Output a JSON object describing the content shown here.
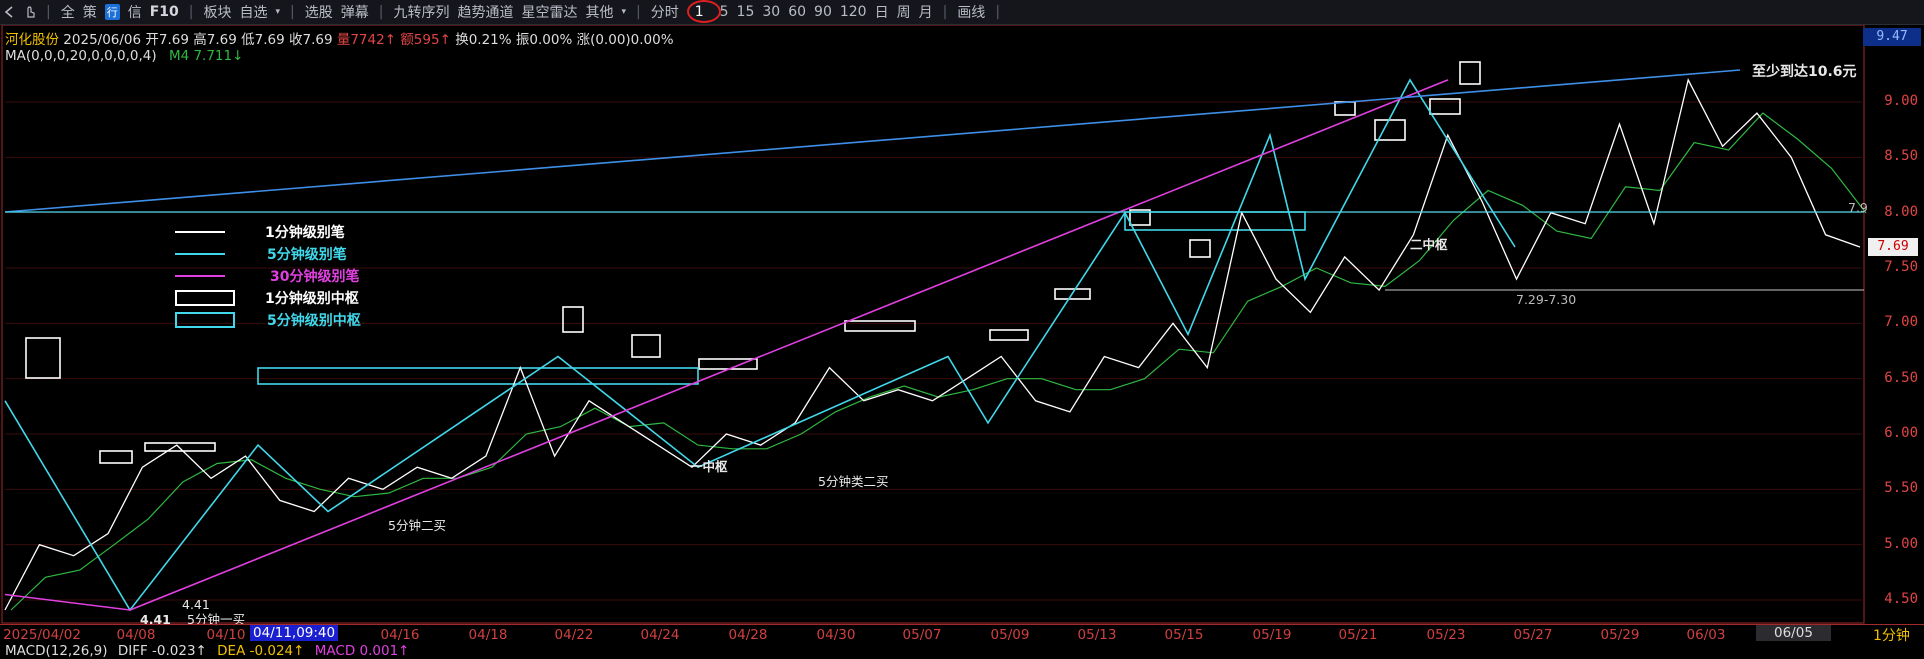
{
  "toolbar": {
    "items": [
      {
        "label": "全"
      },
      {
        "label": "策"
      },
      {
        "label": "行"
      },
      {
        "label": "信"
      },
      {
        "label": "F10"
      },
      {
        "label": "板块"
      },
      {
        "label": "自选"
      },
      {
        "label": "选股"
      },
      {
        "label": "弹幕"
      },
      {
        "label": "九转序列"
      },
      {
        "label": "趋势通道"
      },
      {
        "label": "星空雷达"
      },
      {
        "label": "其他"
      },
      {
        "label": "分时"
      },
      {
        "label": "1"
      },
      {
        "label": "5"
      },
      {
        "label": "15"
      },
      {
        "label": "30"
      },
      {
        "label": "60"
      },
      {
        "label": "90"
      },
      {
        "label": "120"
      },
      {
        "label": "日"
      },
      {
        "label": "周"
      },
      {
        "label": "月"
      },
      {
        "label": "画线"
      }
    ]
  },
  "quote": {
    "name": "河化股份",
    "date": "2025/06/06",
    "open": "开7.69",
    "high": "高7.69",
    "low": "低7.69",
    "close": "收7.69",
    "volume": "量7742↑",
    "amount": "额595↑",
    "turnover": "换0.21%",
    "amplitude": "振0.00%",
    "change": "涨(0.00)0.00%"
  },
  "ma": {
    "params": "MA(0,0,0,20,0,0,0,0,4)",
    "m4": "M4 7.711↓"
  },
  "price_axis": {
    "top": "9.47",
    "current": "7.69",
    "ticks": [
      "9.00",
      "8.50",
      "8.00",
      "7.50",
      "7.00",
      "6.50",
      "6.00",
      "5.50",
      "5.00",
      "4.50"
    ]
  },
  "date_axis": {
    "first": "2025/04/02",
    "cursor": "04/11,09:40",
    "last": "06/05",
    "period": "1分钟",
    "ticks": [
      "04/08",
      "04/10",
      "04/16",
      "04/18",
      "04/22",
      "04/24",
      "04/28",
      "04/30",
      "05/07",
      "05/09",
      "05/13",
      "05/15",
      "05/19",
      "05/21",
      "05/23",
      "05/27",
      "05/29",
      "06/03"
    ]
  },
  "macd": {
    "params": "MACD(12,26,9)",
    "diff": "DIFF -0.023↑",
    "dea": "DEA -0.024↑",
    "macd": "MACD 0.001↑"
  },
  "legend": {
    "items": [
      {
        "label": "1分钟级别笔",
        "color": "#ffffff"
      },
      {
        "label": "5分钟级别笔",
        "color": "#40d8ea"
      },
      {
        "label": "30分钟级别笔",
        "color": "#e040e0"
      },
      {
        "label": "1分钟级别中枢",
        "color": "#ffffff"
      },
      {
        "label": "5分钟级别中枢",
        "color": "#40d8ea"
      }
    ]
  },
  "annotations": {
    "low_price": "4.41",
    "low_price2": "4.41",
    "buy1": "5分钟一买",
    "buy2a": "5分钟二买",
    "center1": "一中枢",
    "buy2b": "5分钟类二买",
    "center2": "二中枢",
    "range": "7.29-7.30",
    "target": "至少到达10.6元",
    "right_val": "7.9"
  },
  "chart_data": {
    "type": "line",
    "title": "河化股份 1分钟",
    "ylim": [
      4.3,
      9.5
    ],
    "price_path": [
      4.41,
      5.0,
      4.9,
      5.1,
      5.7,
      5.9,
      5.6,
      5.8,
      5.4,
      5.3,
      5.6,
      5.5,
      5.7,
      5.6,
      5.8,
      6.6,
      5.8,
      6.3,
      6.1,
      5.9,
      5.7,
      6.0,
      5.9,
      6.1,
      6.6,
      6.3,
      6.4,
      6.3,
      6.5,
      6.7,
      6.3,
      6.2,
      6.7,
      6.6,
      7.0,
      6.6,
      8.0,
      7.4,
      7.1,
      7.6,
      7.3,
      7.8,
      8.7,
      8.1,
      7.4,
      8.0,
      7.9,
      8.8,
      7.9,
      9.2,
      8.6,
      8.9,
      8.5,
      7.8,
      7.69
    ],
    "lines": [
      {
        "name": "5分钟级别笔",
        "color": "#40d8ea",
        "points": [
          [
            0,
            6.3
          ],
          [
            1,
            4.41
          ],
          [
            2,
            5.9
          ],
          [
            3,
            5.3
          ],
          [
            4,
            6.7
          ],
          [
            5,
            5.7
          ],
          [
            6,
            6.7
          ],
          [
            7,
            6.1
          ],
          [
            8,
            8.0
          ],
          [
            9,
            6.9
          ],
          [
            10,
            8.7
          ],
          [
            11,
            7.4
          ],
          [
            12,
            9.2
          ],
          [
            13,
            7.69
          ]
        ]
      },
      {
        "name": "30分钟级别笔",
        "color": "#e040e0",
        "points": [
          [
            0,
            4.55
          ],
          [
            1,
            4.41
          ],
          [
            12,
            9.2
          ]
        ]
      }
    ]
  }
}
